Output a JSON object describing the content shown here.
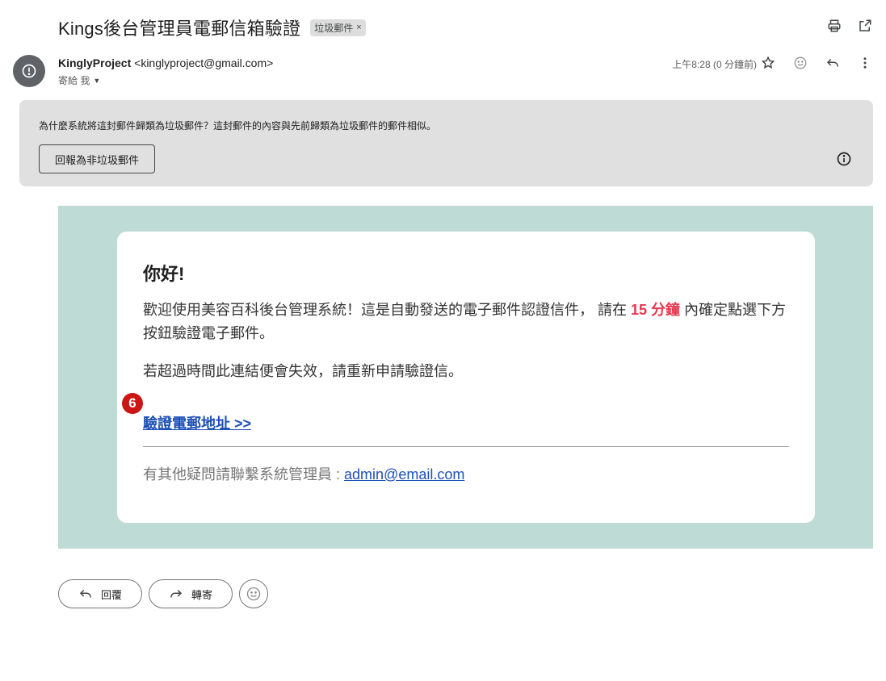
{
  "header": {
    "subject": "Kings後台管理員電郵信箱驗證",
    "label_chip": "垃圾郵件",
    "label_chip_close": "×"
  },
  "sender": {
    "name": "KinglyProject",
    "email": "<kinglyproject@gmail.com>",
    "to_line": "寄給 我",
    "time": "上午8:28 (0 分鐘前)"
  },
  "spam_banner": {
    "message": "為什麼系統將這封郵件歸類為垃圾郵件？這封郵件的內容與先前歸類為垃圾郵件的郵件相似。",
    "report_button": "回報為非垃圾郵件"
  },
  "email_body": {
    "greeting": "你好!",
    "para1_before": "歡迎使用美容百科後台管理系統！這是自動發送的電子郵件認證信件， 請在 ",
    "para1_highlight": "15 分鐘",
    "para1_after": " 內確定點選下方按鈕驗證電子郵件。",
    "para2": "若超過時間此連結便會失效，請重新申請驗證信。",
    "badge": "6",
    "verify_link": "驗證電郵地址 >>",
    "contact_prefix": "有其他疑問請聯繫系統管理員 : ",
    "contact_email": "admin@email.com"
  },
  "actions": {
    "reply": "回覆",
    "forward": "轉寄"
  },
  "icons": {
    "print": "print-icon",
    "open_new": "open-in-new-icon",
    "star": "star-icon",
    "emoji": "emoji-icon",
    "reply": "reply-icon",
    "more": "more-vert-icon",
    "warning": "warning-icon",
    "info": "info-icon",
    "forward": "forward-icon"
  },
  "colors": {
    "email_background": "#bfdbd6",
    "highlight": "#e8364f",
    "link": "#1b4fb8",
    "spam_banner": "#e0e0e0",
    "badge": "#cc1515"
  }
}
